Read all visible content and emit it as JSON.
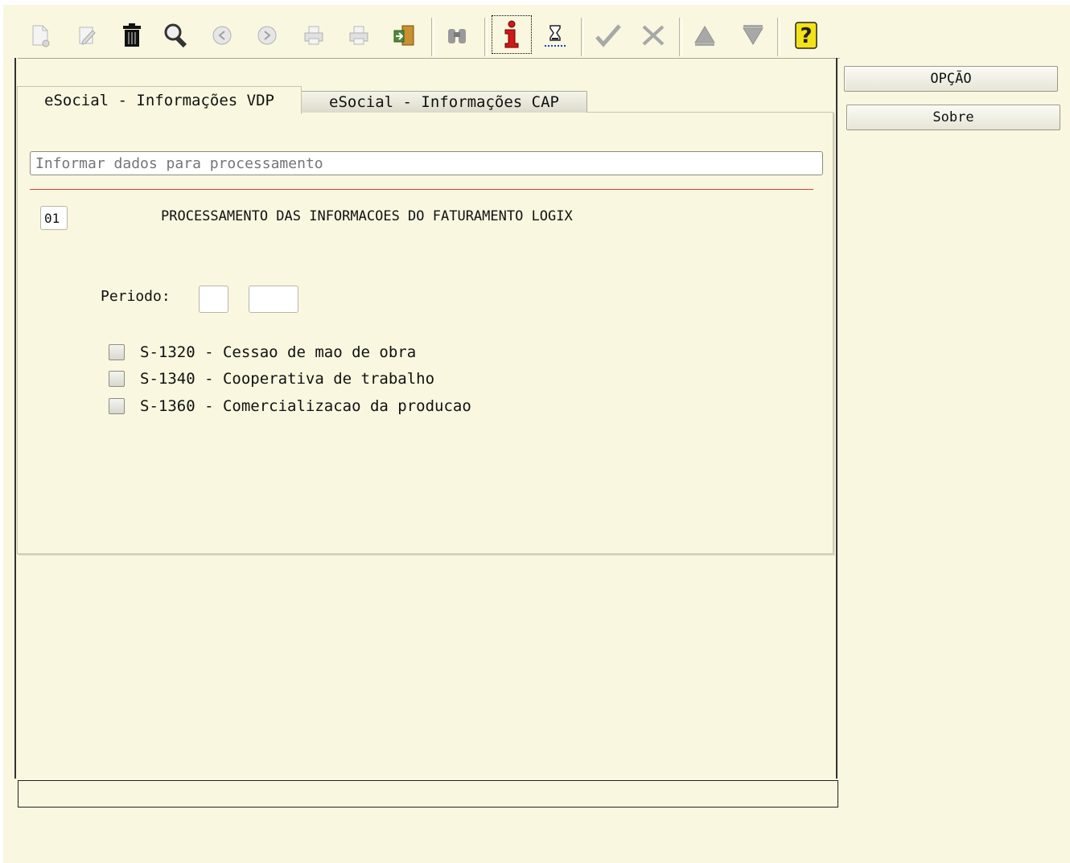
{
  "toolbar": {
    "buttons": [
      {
        "icon": "new-document-icon",
        "enabled": false
      },
      {
        "icon": "edit-icon",
        "enabled": false
      },
      {
        "icon": "trash-icon",
        "enabled": true
      },
      {
        "icon": "search-icon",
        "enabled": true
      },
      {
        "icon": "previous-icon",
        "enabled": false
      },
      {
        "icon": "next-icon",
        "enabled": false
      },
      {
        "icon": "print-icon",
        "enabled": false
      },
      {
        "icon": "print-setup-icon",
        "enabled": false
      },
      {
        "icon": "exit-door-icon",
        "enabled": true
      },
      {
        "icon": "binoculars-icon",
        "enabled": false
      },
      {
        "icon": "info-icon",
        "enabled": true
      },
      {
        "icon": "hourglass-icon",
        "enabled": true
      },
      {
        "icon": "confirm-check-icon",
        "enabled": false
      },
      {
        "icon": "cancel-x-icon",
        "enabled": false
      },
      {
        "icon": "up-arrow-icon",
        "enabled": false
      },
      {
        "icon": "down-arrow-icon",
        "enabled": false
      },
      {
        "icon": "help-question-icon",
        "enabled": true
      }
    ]
  },
  "side_buttons": {
    "option_label": "OPÇÃO",
    "about_label": "Sobre"
  },
  "tabs": [
    {
      "label": "eSocial - Informações VDP",
      "active": true
    },
    {
      "label": "eSocial - Informações CAP",
      "active": false
    }
  ],
  "form": {
    "info_placeholder": "Informar dados para processamento",
    "code": "01",
    "process_title": "PROCESSAMENTO DAS INFORMACOES DO FATURAMENTO LOGIX",
    "period_label": "Periodo:",
    "period_month": "",
    "period_year": "",
    "checkboxes": [
      {
        "label": "S-1320 - Cessao de mao de obra",
        "checked": false
      },
      {
        "label": "S-1340 - Cooperativa de trabalho",
        "checked": false
      },
      {
        "label": "S-1360 - Comercializacao da producao",
        "checked": false
      }
    ]
  },
  "status_bar": {
    "text": ""
  },
  "colors": {
    "background": "#f9f7df",
    "separator_red": "#d04040",
    "info_red": "#d01818",
    "help_yellow": "#f2e21a"
  }
}
